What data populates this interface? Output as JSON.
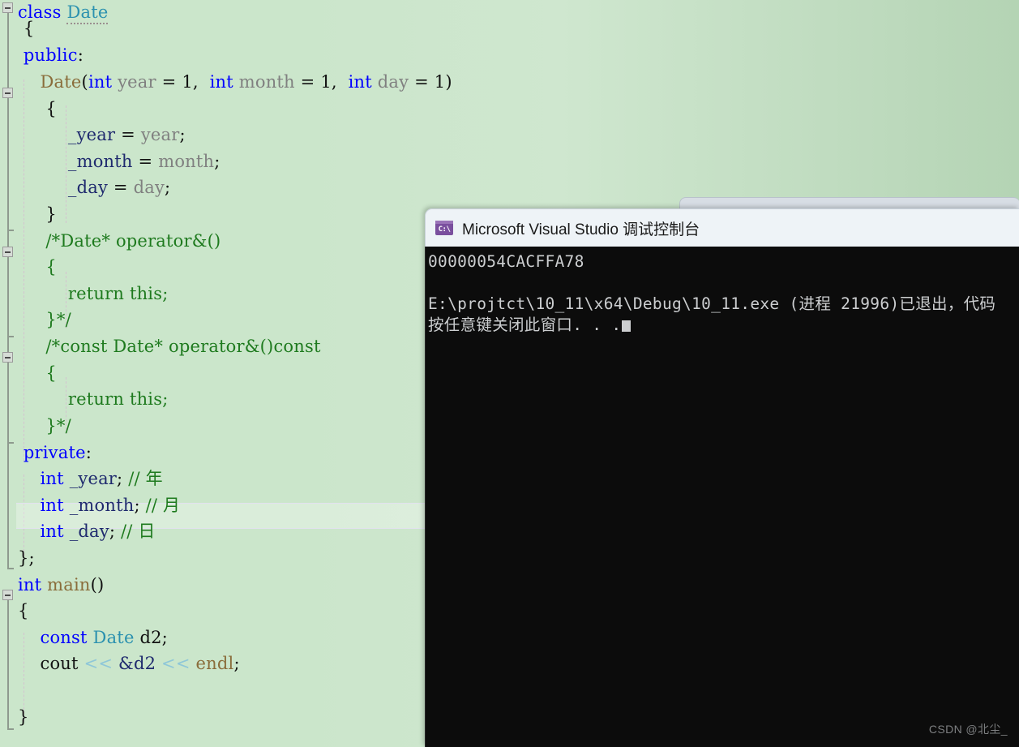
{
  "editor": {
    "name": "visual-studio-code-editor",
    "background_color": "#cbe6cb",
    "highlighted_line_index": 17,
    "lines": [
      {
        "indent": 0,
        "text": "class Date"
      },
      {
        "indent": 0,
        "text": "{"
      },
      {
        "indent": 0,
        "text": "public:"
      },
      {
        "indent": 1,
        "text": "Date(int year = 1, int month = 1, int day = 1)"
      },
      {
        "indent": 1,
        "text": "{"
      },
      {
        "indent": 2,
        "text": "_year = year;"
      },
      {
        "indent": 2,
        "text": "_month = month;"
      },
      {
        "indent": 2,
        "text": "_day = day;"
      },
      {
        "indent": 1,
        "text": "}"
      },
      {
        "indent": 1,
        "text": "/*Date* operator&()"
      },
      {
        "indent": 1,
        "text": "{"
      },
      {
        "indent": 2,
        "text": "return this;"
      },
      {
        "indent": 1,
        "text": "}*/"
      },
      {
        "indent": 1,
        "text": "/*const Date* operator&()const"
      },
      {
        "indent": 1,
        "text": "{"
      },
      {
        "indent": 2,
        "text": "return this;"
      },
      {
        "indent": 1,
        "text": "}*/"
      },
      {
        "indent": 0,
        "text": "private:"
      },
      {
        "indent": 1,
        "text": "int _year; // 年"
      },
      {
        "indent": 1,
        "text": "int _month; // 月"
      },
      {
        "indent": 1,
        "text": "int _day; // 日"
      },
      {
        "indent": 0,
        "text": "};"
      },
      {
        "indent": 0,
        "text": "int main()"
      },
      {
        "indent": 0,
        "text": "{"
      },
      {
        "indent": 1,
        "text": "const Date d2;"
      },
      {
        "indent": 1,
        "text": "cout << &d2 << endl;"
      },
      {
        "indent": 1,
        "text": ""
      },
      {
        "indent": 0,
        "text": "}"
      }
    ],
    "syntax_colors": {
      "keyword": "#0000ff",
      "type": "#2b91af",
      "function": "#8a6d3b",
      "parameter": "#808080",
      "comment": "#1e7a1e",
      "operator": "#8fc7d8",
      "identifier": "#111111"
    }
  },
  "console": {
    "title": "Microsoft Visual Studio 调试控制台",
    "icon": "console-icon",
    "icon_glyph": "C:\\",
    "background_color": "#0c0c0c",
    "text_color": "#ccced0",
    "lines": [
      "00000054CACFFA78",
      "",
      "E:\\projtct\\10_11\\x64\\Debug\\10_11.exe (进程 21996)已退出，代码",
      "按任意键关闭此窗口. . ."
    ]
  },
  "watermark": {
    "text": "CSDN @北尘_"
  }
}
